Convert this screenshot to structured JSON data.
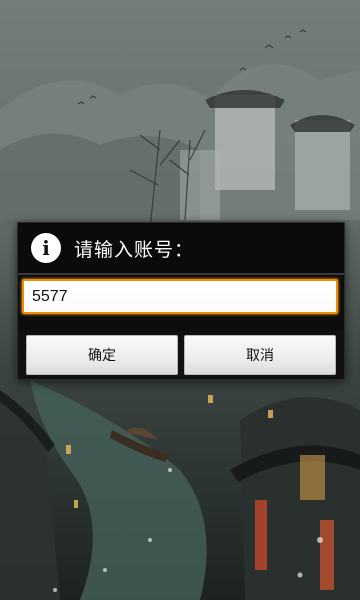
{
  "dialog": {
    "icon": "info-icon",
    "icon_glyph": "i",
    "title": "请输入账号：",
    "input": {
      "value": "5577"
    },
    "buttons": {
      "ok_label": "确定",
      "cancel_label": "取消"
    }
  },
  "colors": {
    "focus_border": "#f28c00",
    "dialog_background": "#0b0b0b"
  }
}
